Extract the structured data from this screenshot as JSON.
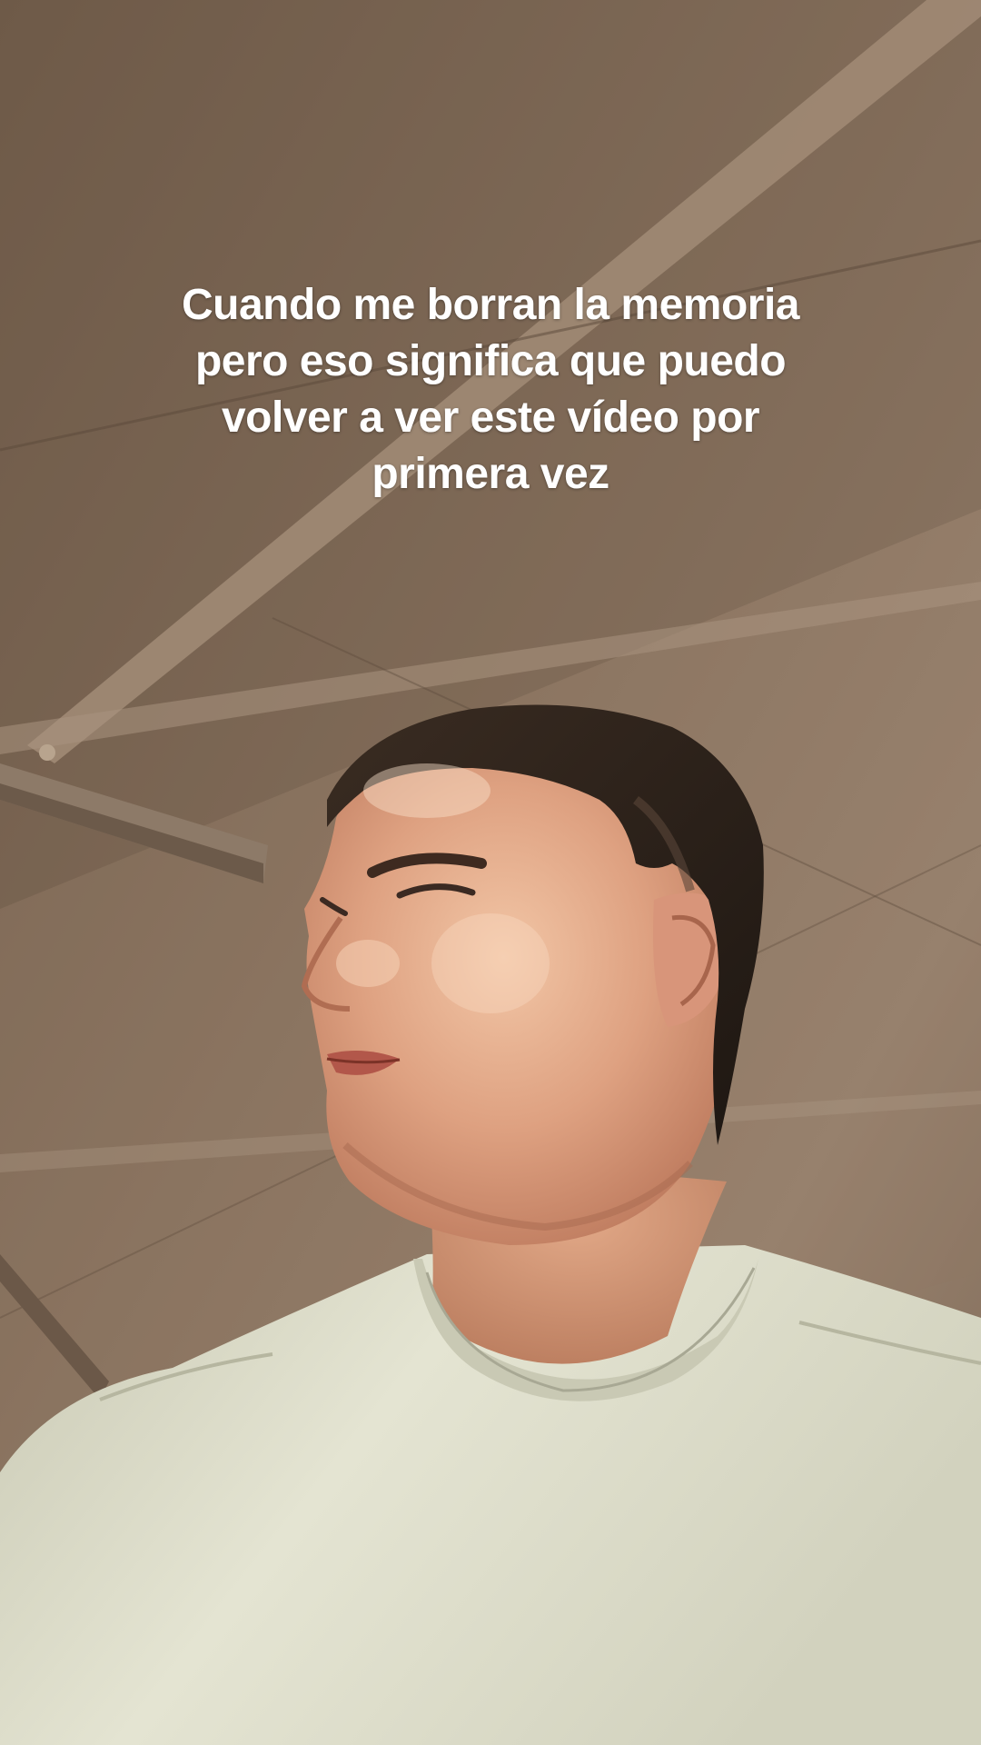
{
  "caption": {
    "lines": [
      "Cuando me borran la memoria",
      "pero eso significa que puedo",
      "volver a ver este vídeo por",
      "primera vez"
    ]
  },
  "colors": {
    "ceiling_light": "#8a7460",
    "ceiling_dark": "#5a4636",
    "beam": "#9c8670",
    "skin": "#d99a7a",
    "skin_highlight": "#f4cfb2",
    "hair": "#2b211b",
    "shirt": "#dcdcc8",
    "shirt_shadow": "#b8b8a2"
  },
  "icons": [
    "person-photo"
  ]
}
